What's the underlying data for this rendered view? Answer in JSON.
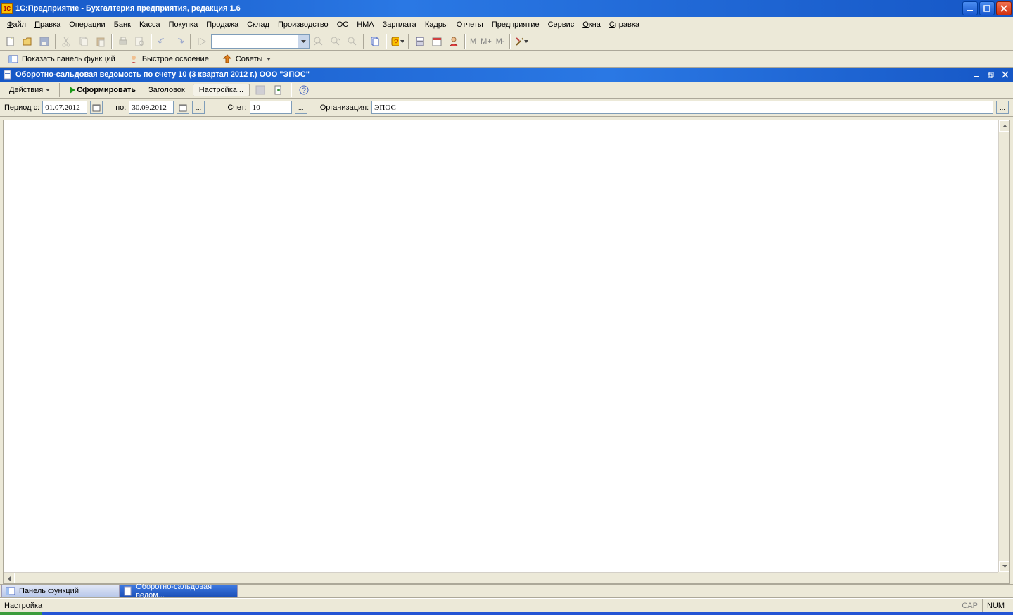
{
  "title": "1С:Предприятие - Бухгалтерия предприятия, редакция 1.6",
  "menu": [
    "Файл",
    "Правка",
    "Операции",
    "Банк",
    "Касса",
    "Покупка",
    "Продажа",
    "Склад",
    "Производство",
    "ОС",
    "НМА",
    "Зарплата",
    "Кадры",
    "Отчеты",
    "Предприятие",
    "Сервис",
    "Окна",
    "Справка"
  ],
  "menu_ul": [
    "Ф",
    "П",
    "",
    "",
    "",
    "",
    "",
    "",
    "",
    "",
    "",
    "",
    "",
    "",
    "",
    "",
    "О",
    "С"
  ],
  "toolbar2": {
    "show_panel": "Показать панель функций",
    "quick_start": "Быстрое освоение",
    "tips": "Советы"
  },
  "mtext": {
    "m": "M",
    "mplus": "M+",
    "mminus": "M-"
  },
  "doc": {
    "title": "Оборотно-сальдовая ведомость по счету 10 (3 квартал 2012 г.) ООО \"ЭПОС\"",
    "actions": "Действия",
    "generate": "Сформировать",
    "header": "Заголовок",
    "settings": "Настройка..."
  },
  "params": {
    "period_from_label": "Период с:",
    "period_from": "01.07.2012",
    "to_label": "по:",
    "period_to": "30.09.2012",
    "account_label": "Счет:",
    "account": "10",
    "org_label": "Организация:",
    "org": "ЭПОС"
  },
  "tabs": {
    "panel": "Панель функций",
    "report": "Оборотно-сальдовая ведом..."
  },
  "status": {
    "text": "Настройка",
    "cap": "CAP",
    "num": "NUM"
  }
}
